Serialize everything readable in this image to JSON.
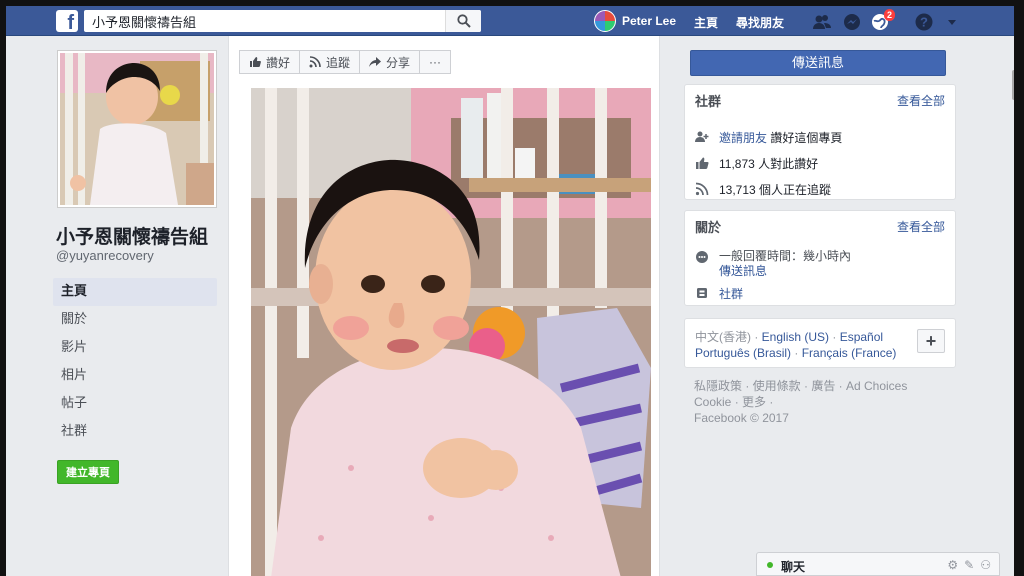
{
  "topbar": {
    "logo": "f",
    "search_value": "小予恩關懷禱告組",
    "search_icon": "search-icon",
    "user_name": "Peter Lee",
    "nav_home": "主頁",
    "nav_find_friends": "尋找朋友",
    "notification_count": "2",
    "icons": [
      "friends-icon",
      "messenger-icon",
      "globe-icon",
      "help-icon",
      "caret-down-icon"
    ]
  },
  "left": {
    "page_title": "小予恩關懷禱告組",
    "page_handle": "@yuyanrecovery",
    "nav": [
      {
        "label": "主頁",
        "active": true
      },
      {
        "label": "關於"
      },
      {
        "label": "影片"
      },
      {
        "label": "相片"
      },
      {
        "label": "帖子"
      },
      {
        "label": "社群"
      }
    ],
    "create_page": "建立專頁"
  },
  "center": {
    "actions": {
      "like": "讚好",
      "follow": "追蹤",
      "share": "分享",
      "more": "···"
    }
  },
  "right": {
    "send_message": "傳送訊息",
    "community": {
      "title": "社群",
      "see_all": "查看全部",
      "invite_link": "邀請朋友",
      "invite_text": "讚好這個專頁",
      "likes_count": "11,873",
      "likes_text": "人對此讚好",
      "followers_count": "13,713",
      "followers_text": "個人正在追蹤"
    },
    "about": {
      "title": "關於",
      "see_all": "查看全部",
      "response_text": "一般回覆時間：幾小時內",
      "send_message_link": "傳送訊息",
      "community_link": "社群"
    },
    "languages": {
      "current": "中文(香港)",
      "sep": " · ",
      "english": "English (US)",
      "espanol": "Español",
      "portugues": "Português (Brasil)",
      "francais": "Français (France)",
      "plus": "+"
    },
    "footer": {
      "line1": "私隱政策 · 使用條款 · 廣告 · Ad Choices",
      "line2": "Cookie · 更多 ·",
      "line3": "Facebook © 2017"
    }
  },
  "chat": {
    "label": "聊天"
  },
  "colors": {
    "brand_blue": "#3b5998",
    "button_blue": "#4267b2",
    "link_blue": "#365899",
    "green": "#42b72a",
    "badge_red": "#fa3e3e"
  }
}
